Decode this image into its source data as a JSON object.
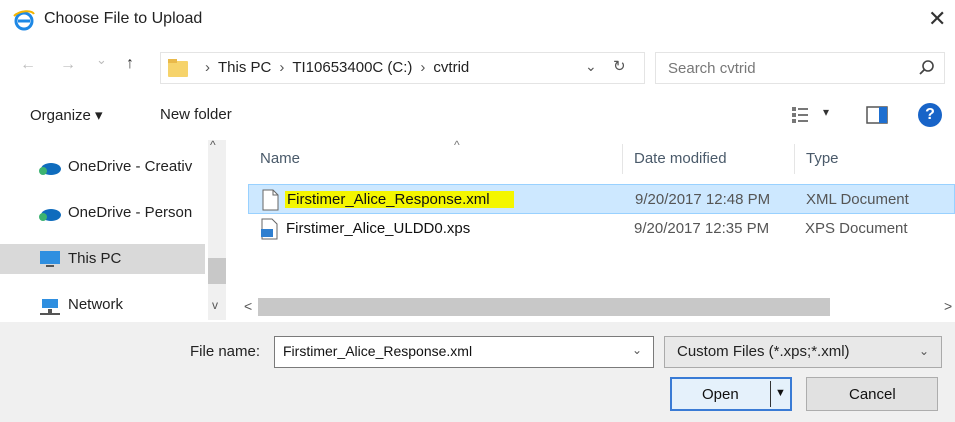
{
  "window": {
    "title": "Choose File to Upload",
    "close_glyph": "✕"
  },
  "nav": {
    "back_glyph": "←",
    "forward_glyph": "→",
    "recent_glyph": "⌄",
    "up_glyph": "↑",
    "breadcrumb": [
      "This PC",
      "TI10653400C (C:)",
      "cvtrid"
    ],
    "sep_glyph": "›",
    "dropdown_glyph": "⌄",
    "refresh_glyph": "↻",
    "search_placeholder": "Search cvtrid"
  },
  "toolbar": {
    "organize": "Organize ▾",
    "new_folder": "New folder",
    "view_dd": "▾",
    "help": "?"
  },
  "sidebar": {
    "items": [
      {
        "label": "OneDrive - Creativ",
        "icon": "onedrive-icon"
      },
      {
        "label": "OneDrive - Person",
        "icon": "onedrive-icon"
      },
      {
        "label": "This PC",
        "icon": "computer-icon",
        "selected": true
      },
      {
        "label": "Network",
        "icon": "network-icon"
      }
    ],
    "scroll_up": "^",
    "scroll_down": "v"
  },
  "columns": {
    "name": "Name",
    "date": "Date modified",
    "type": "Type",
    "sort_glyph": "^"
  },
  "files": [
    {
      "name": "Firstimer_Alice_Response.xml",
      "date": "9/20/2017 12:48 PM",
      "type": "XML Document",
      "selected": true,
      "icon": "xml-file-icon"
    },
    {
      "name": "Firstimer_Alice_ULDD0.xps",
      "date": "9/20/2017 12:35 PM",
      "type": "XPS Document",
      "selected": false,
      "icon": "xps-file-icon"
    }
  ],
  "hscroll": {
    "left": "<",
    "right": ">"
  },
  "footer": {
    "file_name_label": "File name:",
    "file_name_value": "Firstimer_Alice_Response.xml",
    "dd_glyph": "⌄",
    "file_type": "Custom Files (*.xps;*.xml)",
    "open": "Open",
    "cancel": "Cancel",
    "split_arrow": "▼"
  },
  "colors": {
    "accent": "#1864c8",
    "selection": "#cde8ff",
    "highlight": "#f4f600"
  }
}
